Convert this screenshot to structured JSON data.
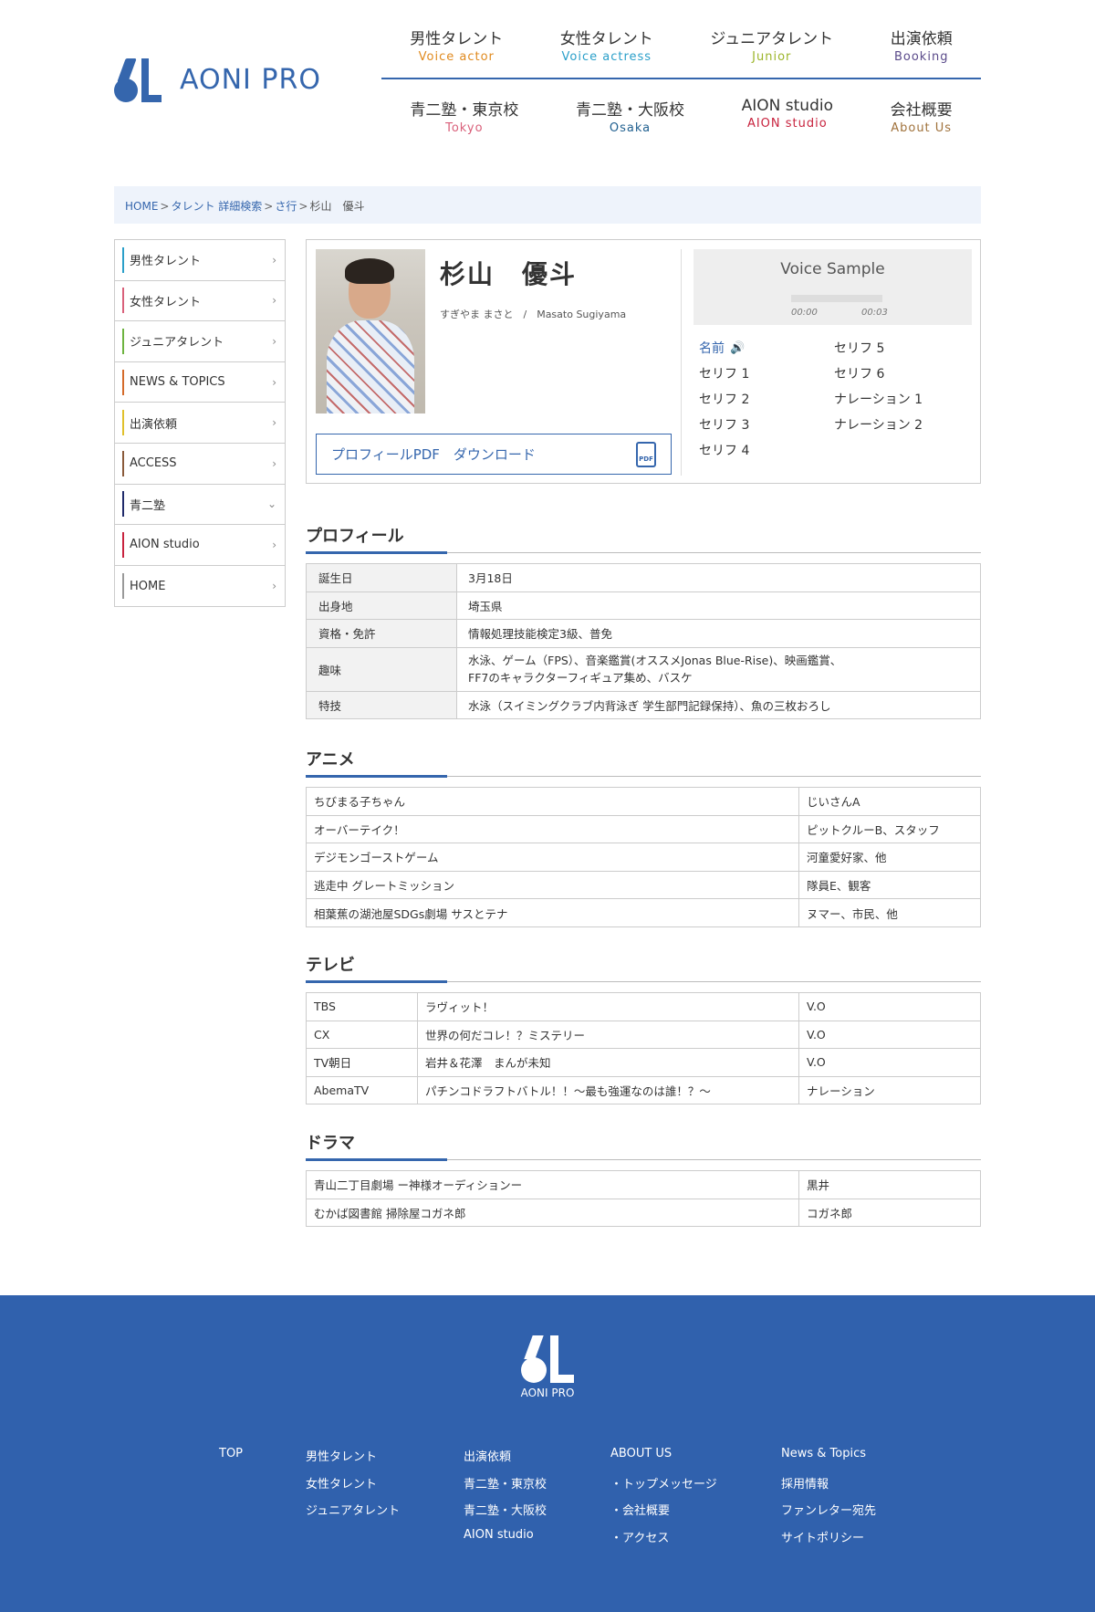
{
  "header": {
    "logo_text": "AONI PRO",
    "nav_top": [
      {
        "jp": "男性タレント",
        "en": "Voice actor",
        "color": "#e08a1e"
      },
      {
        "jp": "女性タレント",
        "en": "Voice actress",
        "color": "#2a9fc9"
      },
      {
        "jp": "ジュニアタレント",
        "en": "Junior",
        "color": "#9cb52a"
      },
      {
        "jp": "出演依頼",
        "en": "Booking",
        "color": "#5a4a8a"
      }
    ],
    "nav_bottom": [
      {
        "jp": "青二塾・東京校",
        "en": "Tokyo",
        "color": "#d9607a"
      },
      {
        "jp": "青二塾・大阪校",
        "en": "Osaka",
        "color": "#1f5f8f"
      },
      {
        "jp": "AION studio",
        "en": "AION studio",
        "color": "#c8233e"
      },
      {
        "jp": "会社概要",
        "en": "About Us",
        "color": "#a0723c"
      }
    ]
  },
  "breadcrumb": {
    "home": "HOME",
    "search": "タレント 詳細検索",
    "group": "さ行",
    "current": "杉山　優斗",
    "sep": ">"
  },
  "sidebar": [
    {
      "label": "男性タレント",
      "color": "#2a9fc9",
      "chev": "›"
    },
    {
      "label": "女性タレント",
      "color": "#d9607a",
      "chev": "›"
    },
    {
      "label": "ジュニアタレント",
      "color": "#6db33f",
      "chev": "›"
    },
    {
      "label": "NEWS & TOPICS",
      "color": "#d46a2a",
      "chev": "›"
    },
    {
      "label": "出演依頼",
      "color": "#e0c02a",
      "chev": "›"
    },
    {
      "label": "ACCESS",
      "color": "#8a5a3a",
      "chev": "›"
    },
    {
      "label": "青二塾",
      "color": "#1f2a6a",
      "chev": "⌄"
    },
    {
      "label": "AION studio",
      "color": "#c8233e",
      "chev": "›"
    },
    {
      "label": "HOME",
      "color": "#999999",
      "chev": "›"
    }
  ],
  "profile": {
    "name": "杉山　優斗",
    "reading": "すぎやま まさと　/　Masato Sugiyama",
    "pdf_label": "プロフィールPDF　ダウンロード",
    "pdf_icon": "PDF"
  },
  "voice": {
    "title": "Voice Sample",
    "time_start": "00:00",
    "time_end": "00:03",
    "items": [
      "名前",
      "セリフ 1",
      "セリフ 2",
      "セリフ 3",
      "セリフ 4",
      "セリフ 5",
      "セリフ 6",
      "ナレーション 1",
      "ナレーション 2"
    ],
    "speaker_icon": "🔊"
  },
  "sections": {
    "profile_title": "プロフィール",
    "anime_title": "アニメ",
    "tv_title": "テレビ",
    "drama_title": "ドラマ"
  },
  "profile_table": [
    {
      "k": "誕生日",
      "v": "3月18日"
    },
    {
      "k": "出身地",
      "v": "埼玉県"
    },
    {
      "k": "資格・免許",
      "v": "情報処理技能検定3級、普免"
    },
    {
      "k": "趣味",
      "v": "水泳、ゲーム（FPS）、音楽鑑賞(オススメJonas Blue-Rise)、映画鑑賞、",
      "v2": "FF7のキャラクターフィギュア集め、バスケ"
    },
    {
      "k": "特技",
      "v": "水泳（スイミングクラブ内背泳ぎ 学生部門記録保持）、魚の三枚おろし"
    }
  ],
  "anime": [
    {
      "title": "ちびまる子ちゃん",
      "role": "じいさんA"
    },
    {
      "title": "オーバーテイク！",
      "role": "ピットクルーB、スタッフ"
    },
    {
      "title": "デジモンゴーストゲーム",
      "role": "河童愛好家、他"
    },
    {
      "title": "逃走中 グレートミッション",
      "role": "隊員E、観客"
    },
    {
      "title": "相葉蕉の湖池屋SDGs劇場 サスとテナ",
      "role": "ヌマー、市民、他"
    }
  ],
  "tv": [
    {
      "station": "TBS",
      "title": "ラヴィット！",
      "role": "V.O"
    },
    {
      "station": "CX",
      "title": "世界の何だコレ！？ミステリー",
      "role": "V.O"
    },
    {
      "station": "TV朝日",
      "title": "岩井＆花澤　まんが未知",
      "role": "V.O"
    },
    {
      "station": "AbemaTV",
      "title": "パチンコドラフトバトル！！〜最も強運なのは誰！？〜",
      "role": "ナレーション"
    }
  ],
  "drama": [
    {
      "title": "青山二丁目劇場 ー神様オーディションー",
      "role": "黒井"
    },
    {
      "title": "むかば図書館 掃除屋コガネ郎",
      "role": "コガネ郎"
    }
  ],
  "footer": {
    "logo_text": "AONI PRO",
    "col1": [
      "TOP"
    ],
    "col2": [
      "男性タレント",
      "女性タレント",
      "ジュニアタレント"
    ],
    "col3": [
      "出演依頼",
      "青二塾・東京校",
      "青二塾・大阪校",
      "AION studio"
    ],
    "col4": [
      "ABOUT US",
      "・トップメッセージ",
      "・会社概要",
      "・アクセス"
    ],
    "col5": [
      "News & Topics",
      "採用情報",
      "ファンレター宛先",
      "サイトポリシー"
    ]
  }
}
